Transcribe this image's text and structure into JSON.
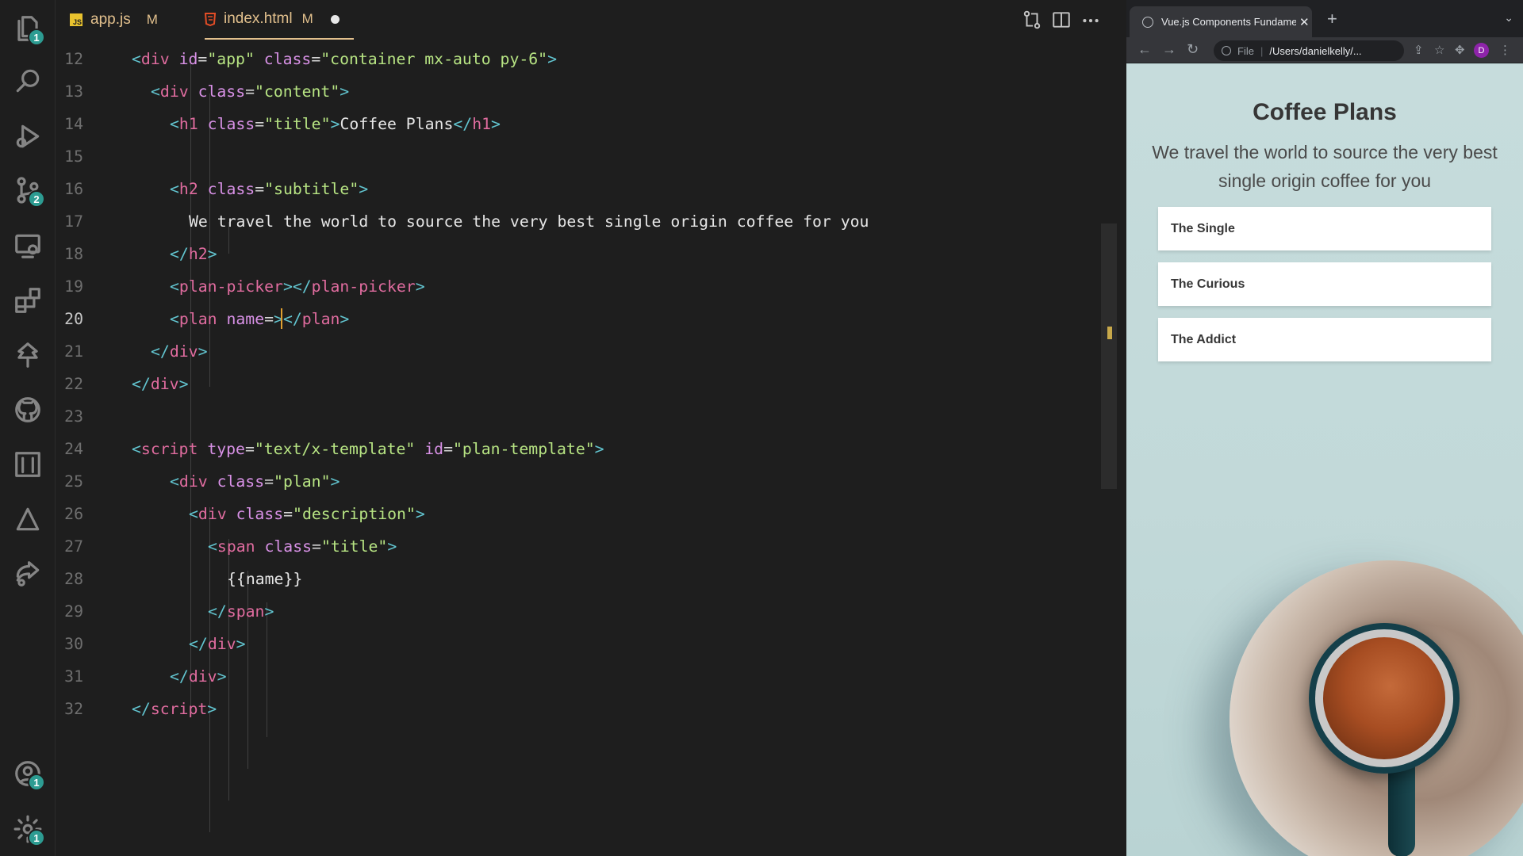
{
  "activity_bar": {
    "items": [
      {
        "name": "explorer",
        "badge": "1"
      },
      {
        "name": "search",
        "badge": ""
      },
      {
        "name": "run-debug",
        "badge": ""
      },
      {
        "name": "source-control",
        "badge": "2"
      },
      {
        "name": "remote-explorer",
        "badge": ""
      },
      {
        "name": "extensions",
        "badge": ""
      },
      {
        "name": "tree",
        "badge": ""
      },
      {
        "name": "github",
        "badge": ""
      },
      {
        "name": "notion",
        "badge": ""
      },
      {
        "name": "deploy",
        "badge": ""
      },
      {
        "name": "live-share",
        "badge": ""
      }
    ],
    "accounts_badge": "1",
    "settings_badge": "1"
  },
  "editor": {
    "tabs": [
      {
        "label": "app.js",
        "flag": "M",
        "icon": "JS"
      },
      {
        "label": "index.html",
        "flag": "M",
        "icon": "html5"
      }
    ],
    "current_line": "20",
    "lines": [
      {
        "n": "12",
        "indent": 0
      },
      {
        "n": "13",
        "indent": 1
      },
      {
        "n": "14",
        "indent": 2
      },
      {
        "n": "15",
        "indent": 2
      },
      {
        "n": "16",
        "indent": 2
      },
      {
        "n": "17",
        "indent": 3
      },
      {
        "n": "18",
        "indent": 2
      },
      {
        "n": "19",
        "indent": 2
      },
      {
        "n": "20",
        "indent": 2
      },
      {
        "n": "21",
        "indent": 1
      },
      {
        "n": "22",
        "indent": 0
      },
      {
        "n": "23",
        "indent": 0
      },
      {
        "n": "24",
        "indent": 0
      },
      {
        "n": "25",
        "indent": 2
      },
      {
        "n": "26",
        "indent": 3
      },
      {
        "n": "27",
        "indent": 4
      },
      {
        "n": "28",
        "indent": 5
      },
      {
        "n": "29",
        "indent": 4
      },
      {
        "n": "30",
        "indent": 3
      },
      {
        "n": "31",
        "indent": 2
      },
      {
        "n": "32",
        "indent": 0
      }
    ],
    "code": {
      "l12": {
        "tag": "div",
        "a1": "id",
        "v1": "\"app\"",
        "a2": "class",
        "v2": "\"container mx-auto py-6\""
      },
      "l13": {
        "tag": "div",
        "a1": "class",
        "v1": "\"content\""
      },
      "l14": {
        "tag": "h1",
        "a1": "class",
        "v1": "\"title\"",
        "text": "Coffee Plans",
        "close": "h1"
      },
      "l16": {
        "tag": "h2",
        "a1": "class",
        "v1": "\"subtitle\""
      },
      "l17": {
        "text": "We travel the world to source the very best single origin coffee for you"
      },
      "l18": {
        "close": "h2"
      },
      "l19": {
        "tag": "plan-picker",
        "close": "plan-picker"
      },
      "l20": {
        "tag": "plan",
        "a1": "name",
        "close": "plan"
      },
      "l21": {
        "close": "div"
      },
      "l22": {
        "close": "div"
      },
      "l24": {
        "tag": "script",
        "a1": "type",
        "v1": "\"text/x-template\"",
        "a2": "id",
        "v2": "\"plan-template\""
      },
      "l25": {
        "tag": "div",
        "a1": "class",
        "v1": "\"plan\""
      },
      "l26": {
        "tag": "div",
        "a1": "class",
        "v1": "\"description\""
      },
      "l27": {
        "tag": "span",
        "a1": "class",
        "v1": "\"title\""
      },
      "l28": {
        "text": "{{name}}"
      },
      "l29": {
        "close": "span"
      },
      "l30": {
        "close": "div"
      },
      "l31": {
        "close": "div"
      },
      "l32": {
        "close": "script"
      }
    }
  },
  "browser": {
    "tab_title": "Vue.js Components Fundamentals",
    "omnibox_scheme": "File",
    "omnibox_url": "/Users/danielkelly/...",
    "avatar_letter": "D",
    "page": {
      "title": "Coffee Plans",
      "subtitle": "We travel the world to source the very best single origin coffee for you",
      "plans": [
        "The Single",
        "The Curious",
        "The Addict"
      ]
    }
  },
  "colors": {
    "editor_bg": "#1e1e1e",
    "badge": "#2d9c92",
    "tag": "#e06c9f",
    "attr": "#d891e6",
    "string": "#b7e483",
    "page_bg": "#c2d9d9"
  }
}
